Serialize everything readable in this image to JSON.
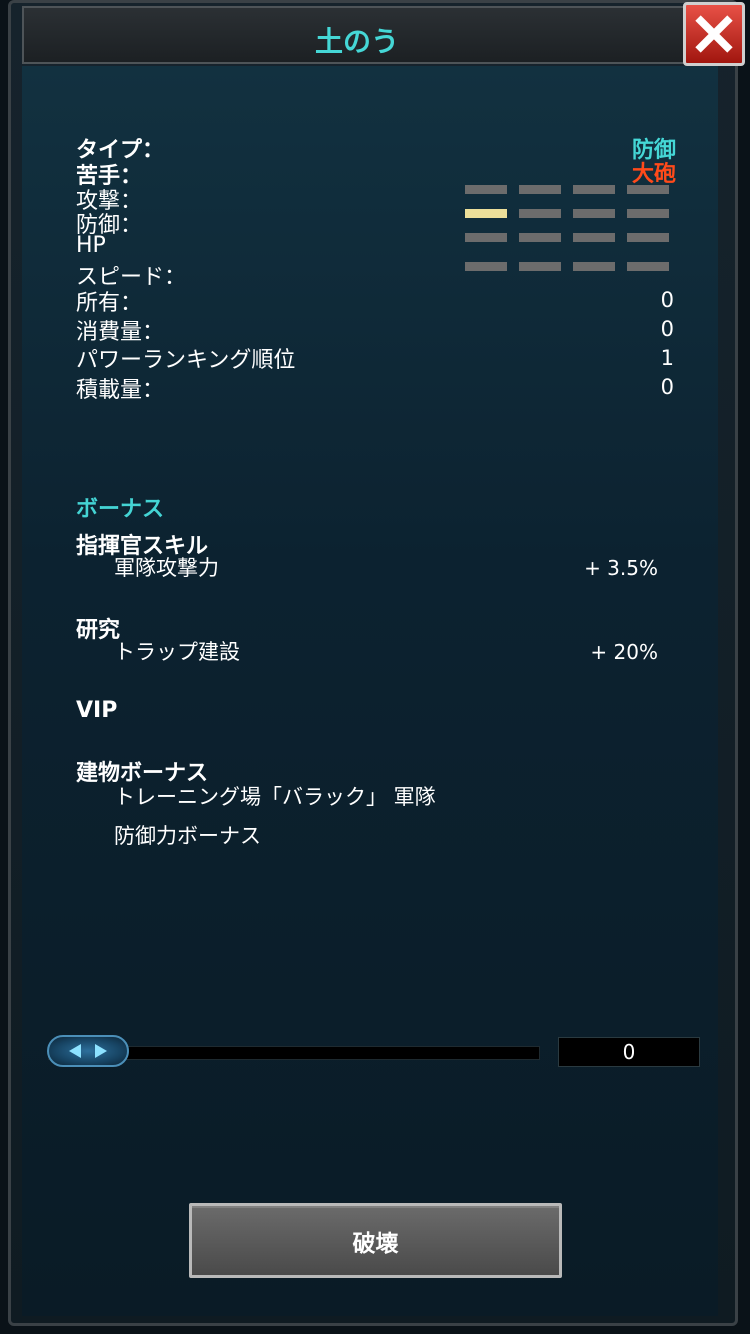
{
  "window": {
    "title": "土のう"
  },
  "stats": {
    "type_label": "タイプ：",
    "type_value": "防御",
    "weak_label": "苦手：",
    "weak_value": "大砲",
    "attack_label": "攻撃：",
    "defense_label": "防御：",
    "hp_label": "HP",
    "speed_label": "スピード：",
    "attack_level": 0,
    "defense_level": 1,
    "hp_level": 0,
    "speed_level": 0,
    "level_max": 4,
    "owned_label": "所有：",
    "owned_value": "0",
    "consumption_label": "消費量：",
    "consumption_value": "0",
    "power_rank_label": "パワーランキング順位",
    "power_rank_value": "1",
    "load_label": "積載量：",
    "load_value": "0"
  },
  "bonus": {
    "title": "ボーナス",
    "commander_skill": {
      "heading": "指揮官スキル",
      "item": "軍隊攻撃力",
      "value": "+ 3.5%"
    },
    "research": {
      "heading": "研究",
      "item": "トラップ建設",
      "value": "+ 20%"
    },
    "vip": {
      "heading": "VIP"
    },
    "building": {
      "heading": "建物ボーナス",
      "item_line1": "トレーニング場「バラック」 軍隊",
      "item_line2": "防御力ボーナス"
    }
  },
  "slider": {
    "quantity": "0"
  },
  "actions": {
    "destroy_label": "破壊"
  },
  "colors": {
    "accent_cyan": "#45d7d6",
    "weak_red": "#ff4a1a",
    "level_on": "#ecdf9a",
    "level_off": "#6c6c6c",
    "close_red": "#d0352b"
  },
  "icons": {
    "close": "close-x-icon",
    "slider_left": "arrow-left-icon",
    "slider_right": "arrow-right-icon"
  }
}
